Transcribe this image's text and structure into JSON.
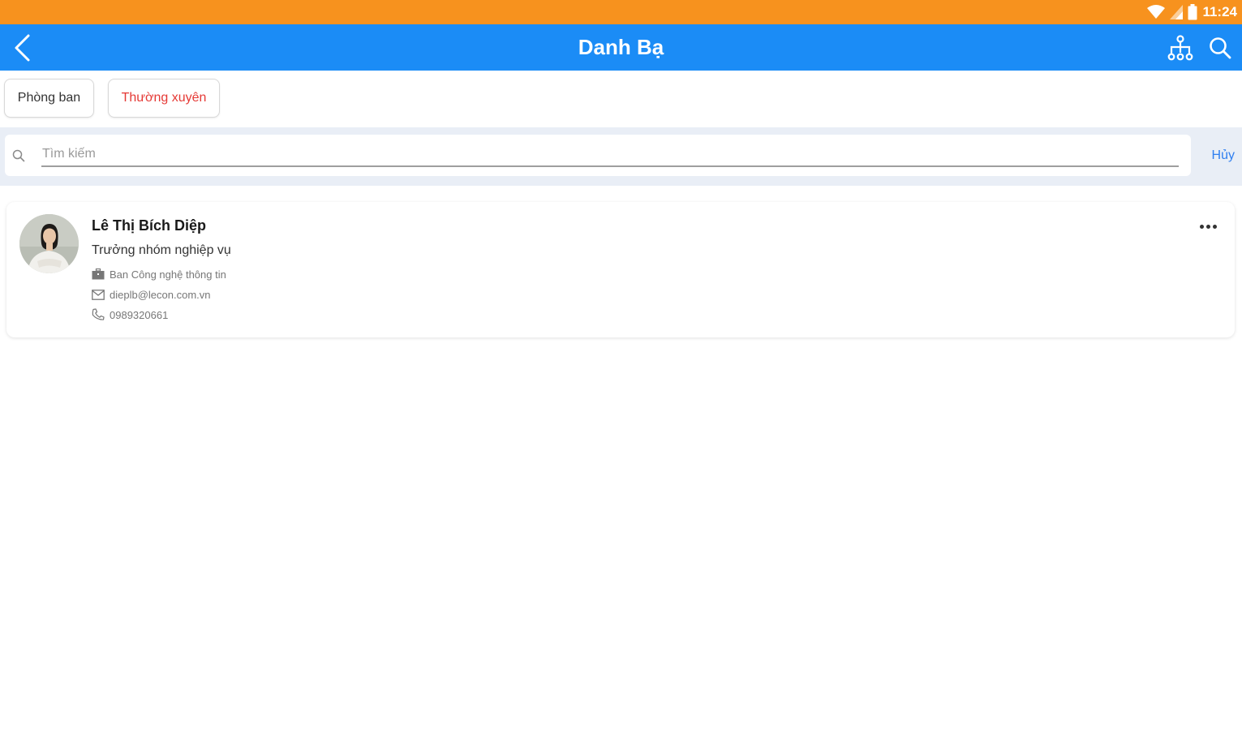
{
  "status_bar": {
    "time": "11:24",
    "background_color": "#f7921e",
    "icons": [
      "wifi-icon",
      "signal-icon",
      "battery-icon"
    ]
  },
  "app_bar": {
    "title": "Danh Bạ",
    "background_color": "#1b8cf6",
    "icons": [
      "back-arrow-icon",
      "org-chart-icon",
      "search-icon"
    ]
  },
  "filters": {
    "department_label": "Phòng ban",
    "frequent_label": "Thường xuyên",
    "frequent_color": "#e53935"
  },
  "search": {
    "placeholder": "Tìm kiếm",
    "value": "",
    "cancel_label": "Hủy",
    "cancel_color": "#2f7ff0"
  },
  "contacts": [
    {
      "name": "Lê Thị Bích Diệp",
      "role": "Trưởng nhóm nghiệp vụ",
      "department": "Ban Công nghệ thông tin",
      "email": "dieplb@lecon.com.vn",
      "phone": "0989320661",
      "icons": [
        "avatar",
        "building-icon",
        "mail-icon",
        "phone-icon",
        "more-icon"
      ]
    }
  ]
}
